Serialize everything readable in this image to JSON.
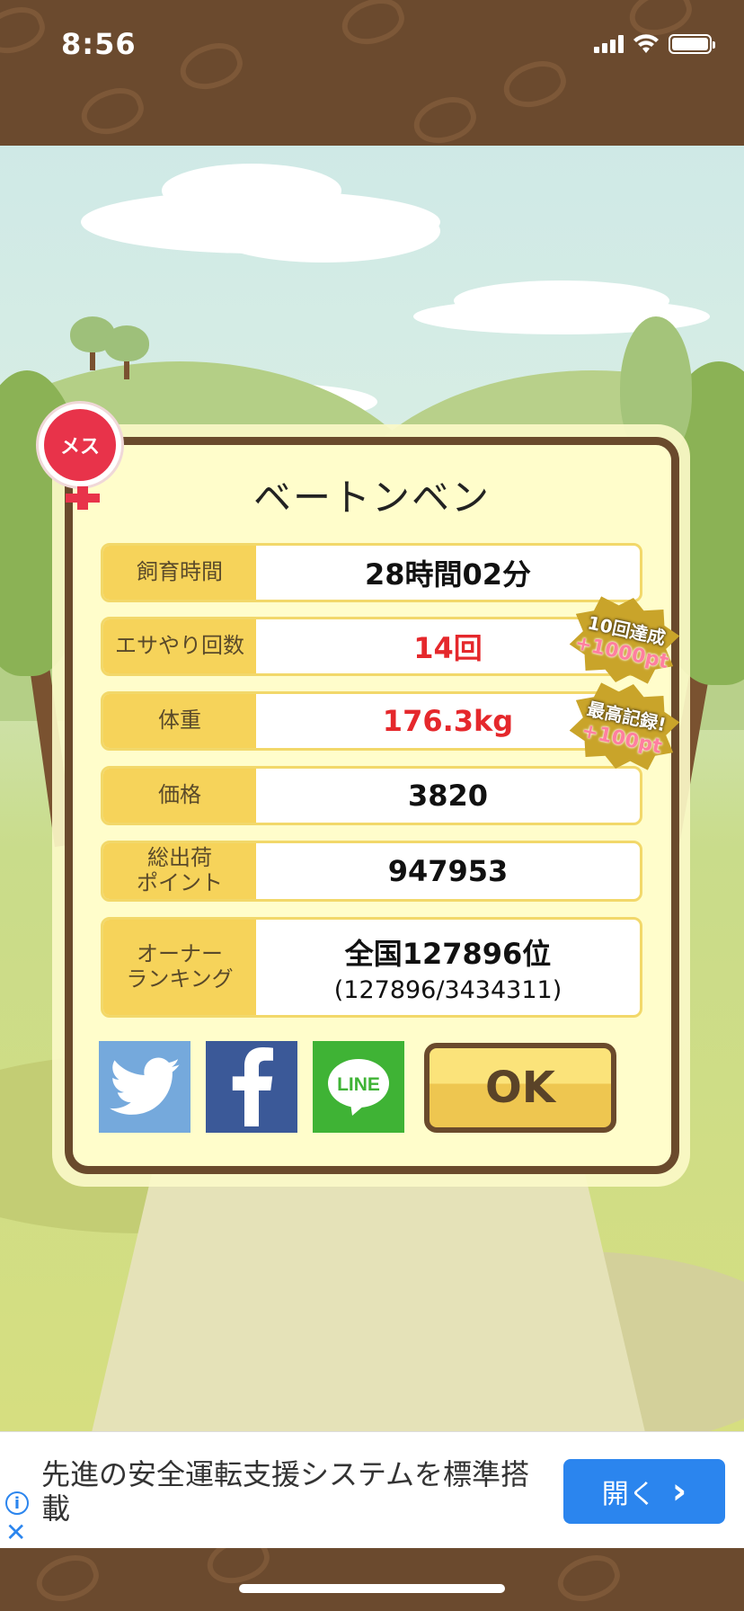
{
  "status_bar": {
    "time": "8:56"
  },
  "character": {
    "sex_badge": "メス",
    "name": "ベートンベン"
  },
  "stats": [
    {
      "label": "飼育時間",
      "value": "28時間02分",
      "highlight": false
    },
    {
      "label": "エサやり回数",
      "value": "14回",
      "highlight": true
    },
    {
      "label": "体重",
      "value": "176.3kg",
      "highlight": true
    },
    {
      "label": "価格",
      "value": "3820",
      "highlight": false
    },
    {
      "label": "総出荷\nポイント",
      "value": "947953",
      "highlight": false
    },
    {
      "label": "オーナー\nランキング",
      "value": "全国127896位",
      "sub": "(127896/3434311)",
      "highlight": false
    }
  ],
  "badges": [
    {
      "line1": "10回達成",
      "line2": "+1000pt"
    },
    {
      "line1": "最高記録!",
      "line2": "+100pt"
    }
  ],
  "share": {
    "line_label": "LINE"
  },
  "ok_button": {
    "label": "OK"
  },
  "ad": {
    "text": "先進の安全運転支援システムを標準搭載",
    "button_label": "開く",
    "button_chevron": "›"
  },
  "colors": {
    "accent_red": "#e5282c",
    "label_yellow": "#f6d35a",
    "frame_brown": "#6a4a2c",
    "ad_blue": "#2b85ee"
  }
}
